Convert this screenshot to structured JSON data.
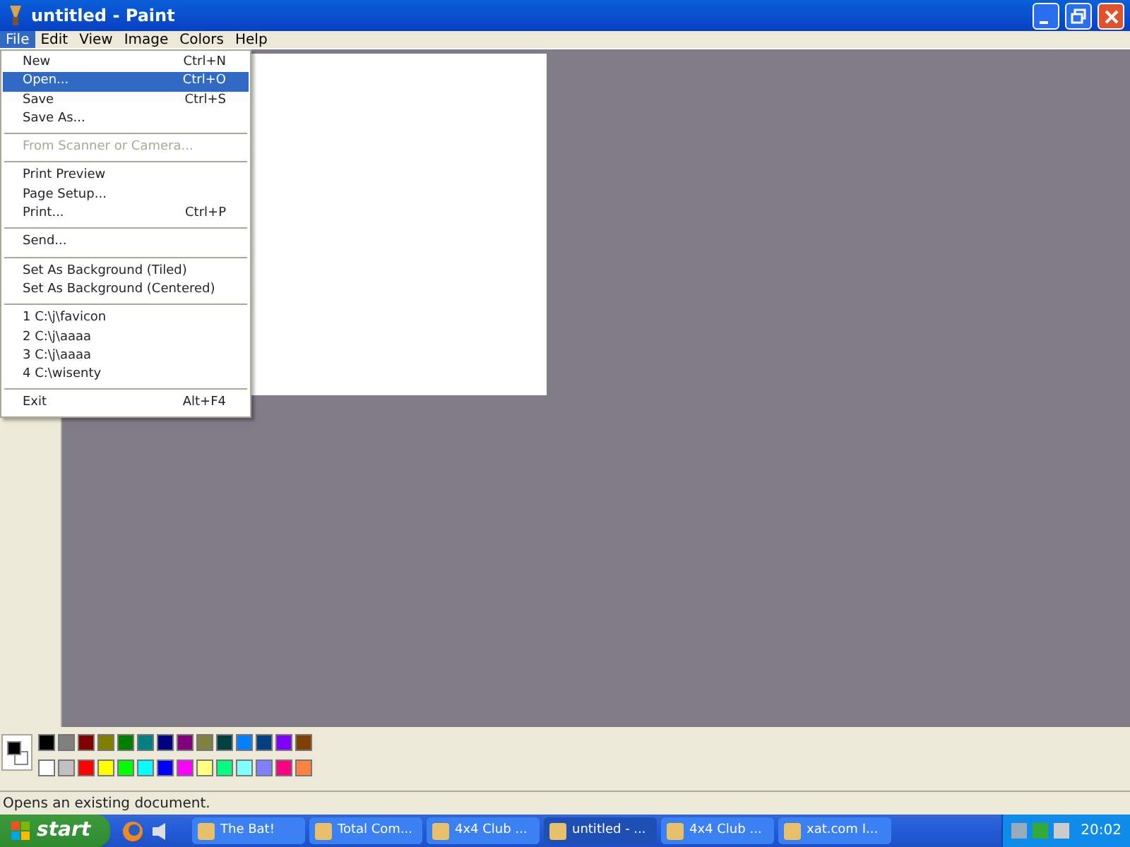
{
  "window": {
    "title": "untitled - Paint"
  },
  "menu_bar": [
    {
      "label": "File",
      "selected": true
    },
    {
      "label": "Edit",
      "selected": false
    },
    {
      "label": "View",
      "selected": false
    },
    {
      "label": "Image",
      "selected": false
    },
    {
      "label": "Colors",
      "selected": false
    },
    {
      "label": "Help",
      "selected": false
    }
  ],
  "file_menu": [
    {
      "kind": "item",
      "label": "New",
      "shortcut": "Ctrl+N",
      "selected": false,
      "disabled": false
    },
    {
      "kind": "item",
      "label": "Open...",
      "shortcut": "Ctrl+O",
      "selected": true,
      "disabled": false
    },
    {
      "kind": "item",
      "label": "Save",
      "shortcut": "Ctrl+S",
      "selected": false,
      "disabled": false
    },
    {
      "kind": "item",
      "label": "Save As...",
      "selected": false,
      "disabled": false
    },
    {
      "kind": "separator"
    },
    {
      "kind": "item",
      "label": "From Scanner or Camera...",
      "selected": false,
      "disabled": true
    },
    {
      "kind": "separator"
    },
    {
      "kind": "item",
      "label": "Print Preview",
      "selected": false,
      "disabled": false
    },
    {
      "kind": "item",
      "label": "Page Setup...",
      "selected": false,
      "disabled": false
    },
    {
      "kind": "item",
      "label": "Print...",
      "shortcut": "Ctrl+P",
      "selected": false,
      "disabled": false
    },
    {
      "kind": "separator"
    },
    {
      "kind": "item",
      "label": "Send...",
      "selected": false,
      "disabled": false
    },
    {
      "kind": "separator"
    },
    {
      "kind": "item",
      "label": "Set As Background (Tiled)",
      "selected": false,
      "disabled": false
    },
    {
      "kind": "item",
      "label": "Set As Background (Centered)",
      "selected": false,
      "disabled": false
    },
    {
      "kind": "separator"
    },
    {
      "kind": "item",
      "label": "1 C:\\j\\favicon",
      "selected": false,
      "disabled": false
    },
    {
      "kind": "item",
      "label": "2 C:\\j\\aaaa",
      "selected": false,
      "disabled": false
    },
    {
      "kind": "item",
      "label": "3 C:\\j\\aaaa",
      "selected": false,
      "disabled": false
    },
    {
      "kind": "item",
      "label": "4 C:\\wisenty",
      "selected": false,
      "disabled": false
    },
    {
      "kind": "separator"
    },
    {
      "kind": "item",
      "label": "Exit",
      "shortcut": "Alt+F4",
      "selected": false,
      "disabled": false
    }
  ],
  "palette": {
    "foreground": {
      "color": "#000000"
    },
    "background": {
      "color": "#ffffff"
    },
    "colors": [
      {
        "color": "#000000"
      },
      {
        "color": "#808080"
      },
      {
        "color": "#800000"
      },
      {
        "color": "#808000"
      },
      {
        "color": "#008000"
      },
      {
        "color": "#008080"
      },
      {
        "color": "#000080"
      },
      {
        "color": "#800080"
      },
      {
        "color": "#808040"
      },
      {
        "color": "#004040"
      },
      {
        "color": "#0080ff"
      },
      {
        "color": "#004080"
      },
      {
        "color": "#8000ff"
      },
      {
        "color": "#804000"
      },
      {
        "color": "#ffffff"
      },
      {
        "color": "#c0c0c0"
      },
      {
        "color": "#ff0000"
      },
      {
        "color": "#ffff00"
      },
      {
        "color": "#00ff00"
      },
      {
        "color": "#00ffff"
      },
      {
        "color": "#0000ff"
      },
      {
        "color": "#ff00ff"
      },
      {
        "color": "#ffff80"
      },
      {
        "color": "#00ff80"
      },
      {
        "color": "#80ffff"
      },
      {
        "color": "#8080ff"
      },
      {
        "color": "#ff0080"
      },
      {
        "color": "#ff8040"
      }
    ]
  },
  "status_bar": "Opens an existing document.",
  "taskbar": {
    "start": "start",
    "buttons": [
      {
        "label": "The Bat!",
        "selected": false
      },
      {
        "label": "Total Com...",
        "selected": false
      },
      {
        "label": "4x4 Club ...",
        "selected": false
      },
      {
        "label": "untitled - ...",
        "selected": true
      },
      {
        "label": "4x4 Club ...",
        "selected": false
      },
      {
        "label": "xat.com  I...",
        "selected": false
      }
    ],
    "clock": "20:02"
  }
}
